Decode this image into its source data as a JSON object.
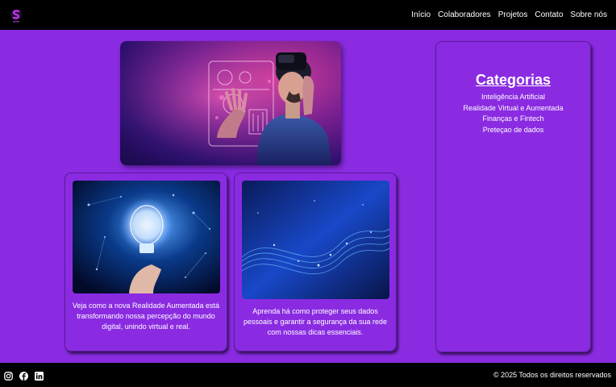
{
  "colors": {
    "background": "#8a2be2",
    "bar": "#000000",
    "accent": "#b03cd8"
  },
  "header": {
    "logo_icon": "brand-logo-icon",
    "nav": [
      "Início",
      "Colaboradores",
      "Projetos",
      "Contato",
      "Sobre nós"
    ]
  },
  "hero": {
    "image": "vr-headset-person-image"
  },
  "cards": [
    {
      "image": "lightbulb-network-image",
      "text": "Veja como a nova Realidade Aumentada está transformando nossa percepção do mundo digital, unindo virtual e real."
    },
    {
      "image": "blue-data-wave-image",
      "text": "Aprenda há como proteger seus dados pessoais e garantir a segurança da sua rede com nossas dicas essenciais."
    }
  ],
  "sidebar": {
    "title": "Categorias",
    "items": [
      "Inteligência Artificial",
      "Realidade Virtual e Aumentada",
      "Finanças e Fintech",
      "Preteçao de dados"
    ]
  },
  "footer": {
    "social": [
      "instagram-icon",
      "facebook-icon",
      "linkedin-icon"
    ],
    "copyright": "© 2025 Todos os direitos reservados"
  }
}
